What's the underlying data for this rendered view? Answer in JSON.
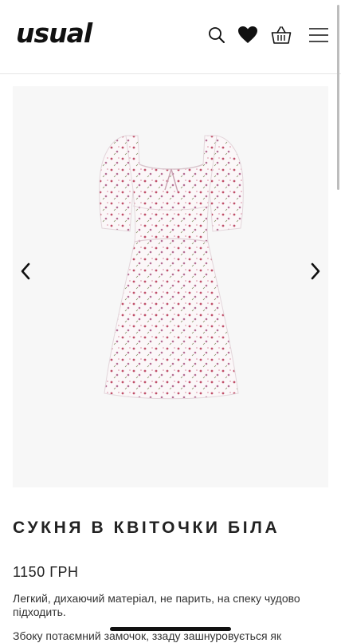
{
  "header": {
    "logo": "usual"
  },
  "product": {
    "title": "СУКНЯ В КВІТОЧКИ БІЛА",
    "price": "1150 ГРН",
    "description": "Легкий, дихаючий матеріал, не парить, на спеку чудово підходить.",
    "description_more": "Збоку потаємний замочок, ззаду зашнуровується як"
  },
  "icons": {
    "search": "search-icon",
    "wishlist": "heart-icon",
    "cart": "basket-icon",
    "menu": "hamburger-menu-icon",
    "prev": "chevron-left-icon",
    "next": "chevron-right-icon"
  },
  "colors": {
    "accent": "#111111",
    "dress_print": "#c0506a"
  }
}
